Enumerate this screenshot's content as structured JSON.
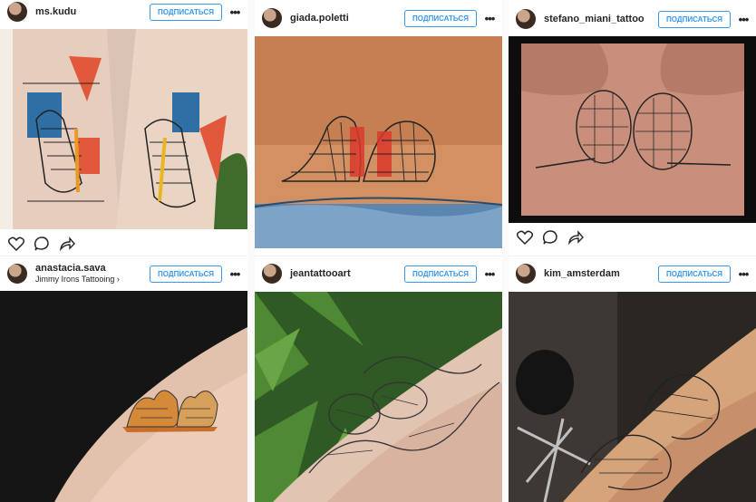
{
  "follow_label": "ПОДПИСАТЬСЯ",
  "more_glyph": "•••",
  "icons": {
    "like": "heart-icon",
    "comment": "comment-icon",
    "share": "share-icon",
    "more": "more-options-icon"
  },
  "colors": {
    "follow_blue": "#3897f0",
    "text": "#262626",
    "divider": "#efefef"
  },
  "posts": [
    {
      "username": "ms.kudu",
      "location": ""
    },
    {
      "username": "giada.poletti",
      "location": ""
    },
    {
      "username": "stefano_miani_tattoo",
      "location": ""
    },
    {
      "username": "anastacia.sava",
      "location": "Jimmy Irons Tattooing ›"
    },
    {
      "username": "jeantattooart",
      "location": ""
    },
    {
      "username": "kim_amsterdam",
      "location": ""
    }
  ]
}
